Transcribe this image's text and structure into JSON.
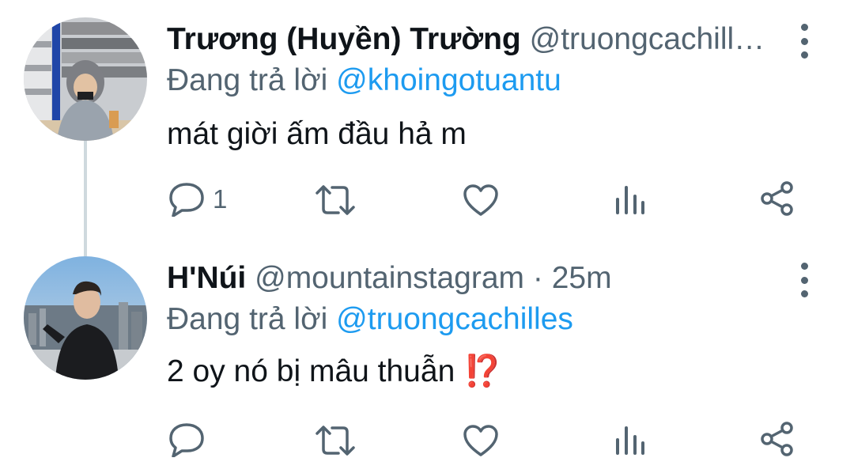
{
  "tweets": [
    {
      "name": "Trương (Huyền) Trường",
      "handle": "@truongcachill…",
      "reply_prefix": "Đang trả lời",
      "reply_to": "@khoingotuantu",
      "text": "mát giời ấm đầu hả m",
      "reply_count": "1"
    },
    {
      "name": "H'Núi",
      "handle": "@mountainstagram",
      "time": "· 25m",
      "reply_prefix": "Đang trả lời",
      "reply_to": "@truongcachilles",
      "text": "2 oy nó bị mâu thuẫn",
      "emoji": "⁉️"
    }
  ],
  "icons": {
    "reply": "reply-icon",
    "retweet": "retweet-icon",
    "like": "heart-icon",
    "views": "bar-chart-icon",
    "share": "share-icon",
    "more": "more-vertical-icon"
  },
  "colors": {
    "mention": "#1d9bf0",
    "secondary_text": "#536471",
    "thread_line": "#cfd9de"
  }
}
